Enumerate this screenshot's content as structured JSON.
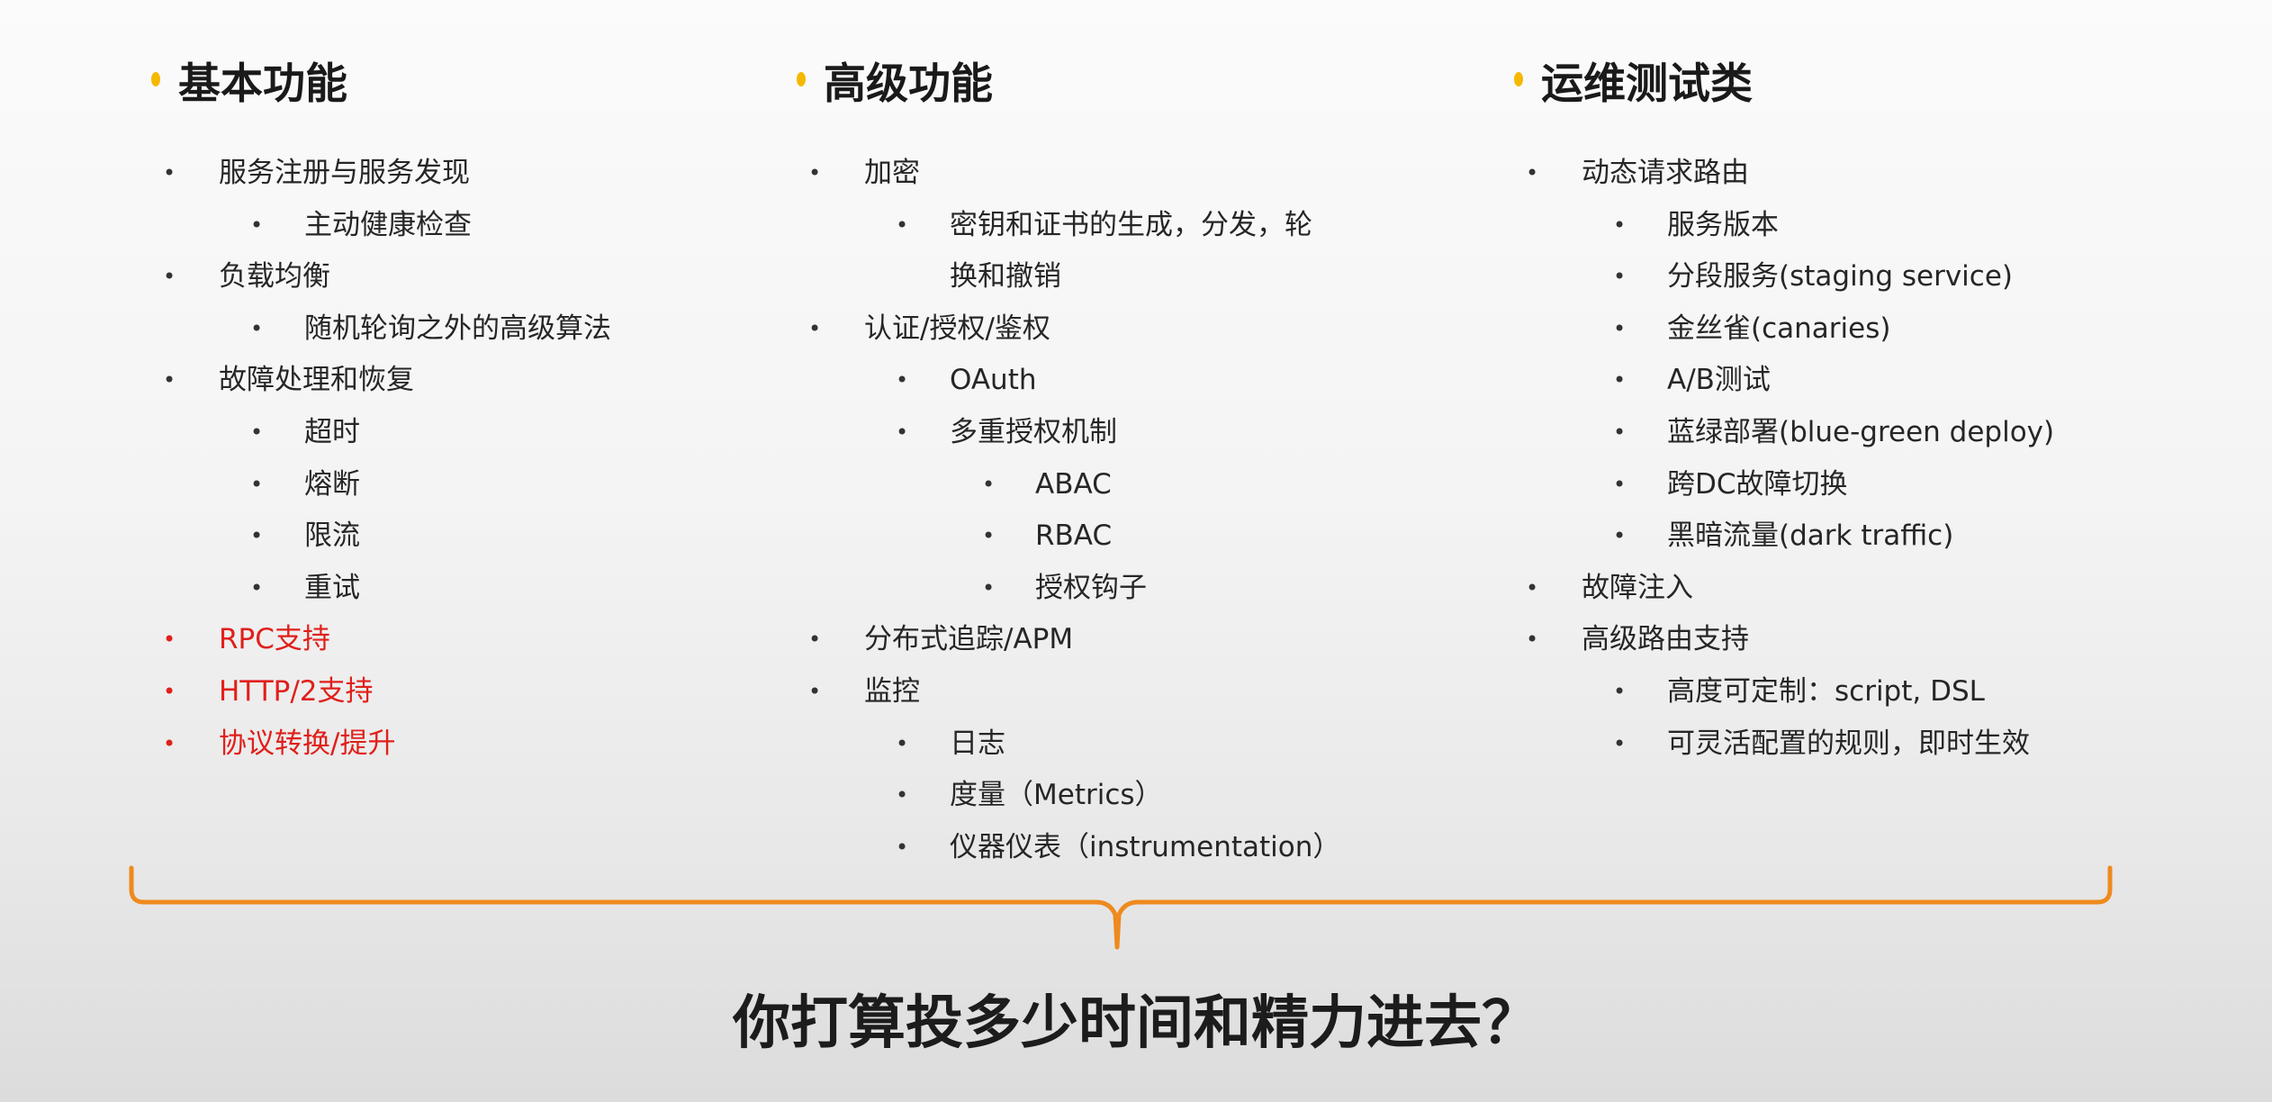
{
  "columns": [
    {
      "title": "基本功能",
      "items": [
        {
          "text": "服务注册与服务发现",
          "level": 1
        },
        {
          "text": "主动健康检查",
          "level": 2
        },
        {
          "text": "负载均衡",
          "level": 1
        },
        {
          "text": "随机轮询之外的高级算法",
          "level": 2
        },
        {
          "text": "故障处理和恢复",
          "level": 1
        },
        {
          "text": "超时",
          "level": 2
        },
        {
          "text": "熔断",
          "level": 2
        },
        {
          "text": "限流",
          "level": 2
        },
        {
          "text": "重试",
          "level": 2
        },
        {
          "text": "RPC支持",
          "level": 1,
          "color": "red"
        },
        {
          "text": "HTTP/2支持",
          "level": 1,
          "color": "red"
        },
        {
          "text": "协议转换/提升",
          "level": 1,
          "color": "red"
        }
      ]
    },
    {
      "title": "高级功能",
      "items": [
        {
          "text": "加密",
          "level": 1
        },
        {
          "text": "密钥和证书的生成，分发，轮",
          "level": 2
        },
        {
          "text": "换和撤销",
          "level": 2,
          "continuation": true
        },
        {
          "text": "认证/授权/鉴权",
          "level": 1
        },
        {
          "text": "OAuth",
          "level": 2
        },
        {
          "text": "多重授权机制",
          "level": 2
        },
        {
          "text": "ABAC",
          "level": 3
        },
        {
          "text": "RBAC",
          "level": 3
        },
        {
          "text": "授权钩子",
          "level": 3
        },
        {
          "text": "分布式追踪/APM",
          "level": 1
        },
        {
          "text": "监控",
          "level": 1
        },
        {
          "text": "日志",
          "level": 2
        },
        {
          "text": "度量（Metrics）",
          "level": 2
        },
        {
          "text": "仪器仪表（instrumentation）",
          "level": 2
        }
      ]
    },
    {
      "title": "运维测试类",
      "items": [
        {
          "text": "动态请求路由",
          "level": 1
        },
        {
          "text": "服务版本",
          "level": 2
        },
        {
          "text": "分段服务(staging service)",
          "level": 2
        },
        {
          "text": "金丝雀(canaries)",
          "level": 2
        },
        {
          "text": "A/B测试",
          "level": 2
        },
        {
          "text": "蓝绿部署(blue-green deploy)",
          "level": 2
        },
        {
          "text": "跨DC故障切换",
          "level": 2
        },
        {
          "text": "黑暗流量(dark traffic)",
          "level": 2
        },
        {
          "text": "故障注入",
          "level": 1
        },
        {
          "text": "高级路由支持",
          "level": 1
        },
        {
          "text": "高度可定制：script, DSL",
          "level": 2
        },
        {
          "text": "可灵活配置的规则，即时生效",
          "level": 2
        }
      ]
    }
  ],
  "bottom_question": "你打算投多少时间和精力进去？",
  "colors": {
    "title_dot": "#f5b800",
    "highlight_red": "#e0201b",
    "brace": "#ee8a1e",
    "text": "#262626"
  },
  "icons": {
    "title_marker": "yellow-dot",
    "list_marker": "bullet"
  }
}
